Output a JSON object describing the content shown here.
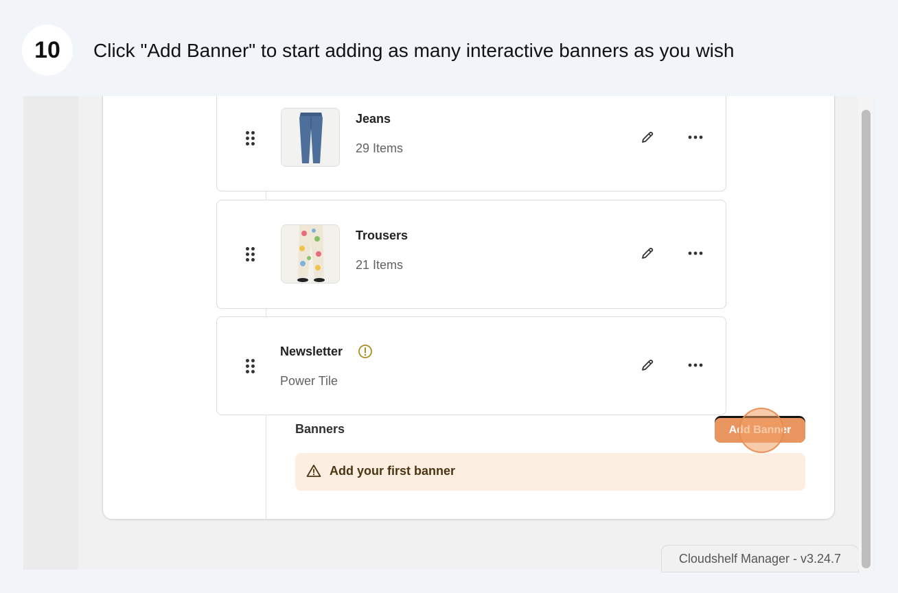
{
  "step": {
    "number": "10",
    "instruction": "Click \"Add Banner\" to start adding as many interactive banners as you wish"
  },
  "items": [
    {
      "title": "Jeans",
      "subtitle": "29 Items",
      "thumbnail": "jeans-image"
    },
    {
      "title": "Trousers",
      "subtitle": "21 Items",
      "thumbnail": "trousers-image"
    },
    {
      "title": "Newsletter",
      "subtitle": "Power Tile",
      "warning_icon": "info-circle-icon"
    }
  ],
  "banners": {
    "label": "Banners",
    "add_button_label": "Add Banner",
    "empty_message": "Add your first banner"
  },
  "footer": {
    "version": "Cloudshelf Manager - v3.24.7"
  },
  "colors": {
    "accent": "#e8955f",
    "warning_bg": "#fdeee2",
    "warning_text": "#4a3512",
    "info_icon": "#b08a1e"
  }
}
